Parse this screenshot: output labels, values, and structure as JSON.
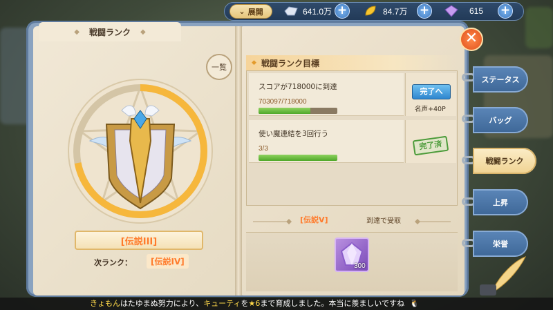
{
  "top_bar": {
    "expand_label": "展開",
    "resources": [
      {
        "icon": "crystal-icon",
        "value": "641.0万"
      },
      {
        "icon": "gold-leaf-icon",
        "value": "84.7万"
      },
      {
        "icon": "gem-icon",
        "value": "615"
      }
    ]
  },
  "panel": {
    "title": "戦闘ランク",
    "list_button": "一覧",
    "current_rank": "[伝説III]",
    "next_rank_label": "次ランク：",
    "next_rank_value": "[伝説IV]",
    "rank_progress": 0.72
  },
  "goals": {
    "header": "戦闘ランク目標",
    "items": [
      {
        "text": "スコアが718000に到達",
        "progress_text": "703097/718000",
        "progress": 0.66,
        "action": "完了へ",
        "reward": "名声+40P"
      },
      {
        "text": "使い魔連結を3回行う",
        "progress_text": "3/3",
        "progress": 1.0,
        "status": "完了済"
      }
    ]
  },
  "reward": {
    "rank": "[伝説V]",
    "condition": "到達で受取",
    "item_icon": "crystal-gem-icon",
    "item_qty": "300"
  },
  "side_tabs": [
    {
      "label": "ステータス",
      "active": false
    },
    {
      "label": "バッグ",
      "active": false
    },
    {
      "label": "戦闘ランク",
      "active": true
    },
    {
      "label": "上昇",
      "active": false
    },
    {
      "label": "栄誉",
      "active": false
    }
  ],
  "chat": {
    "name": "きょもん",
    "text_1": "はたゆまぬ努力により、",
    "pet": "キューティ",
    "text_2": "を",
    "star": "★6",
    "text_3": "まで育成しました。本当に羨ましいですね"
  },
  "colors": {
    "accent_orange": "#ff7a2a",
    "tab_blue": "#4a74a6",
    "progress_green": "#5fb83a",
    "ring_gold": "#f6b73c"
  }
}
